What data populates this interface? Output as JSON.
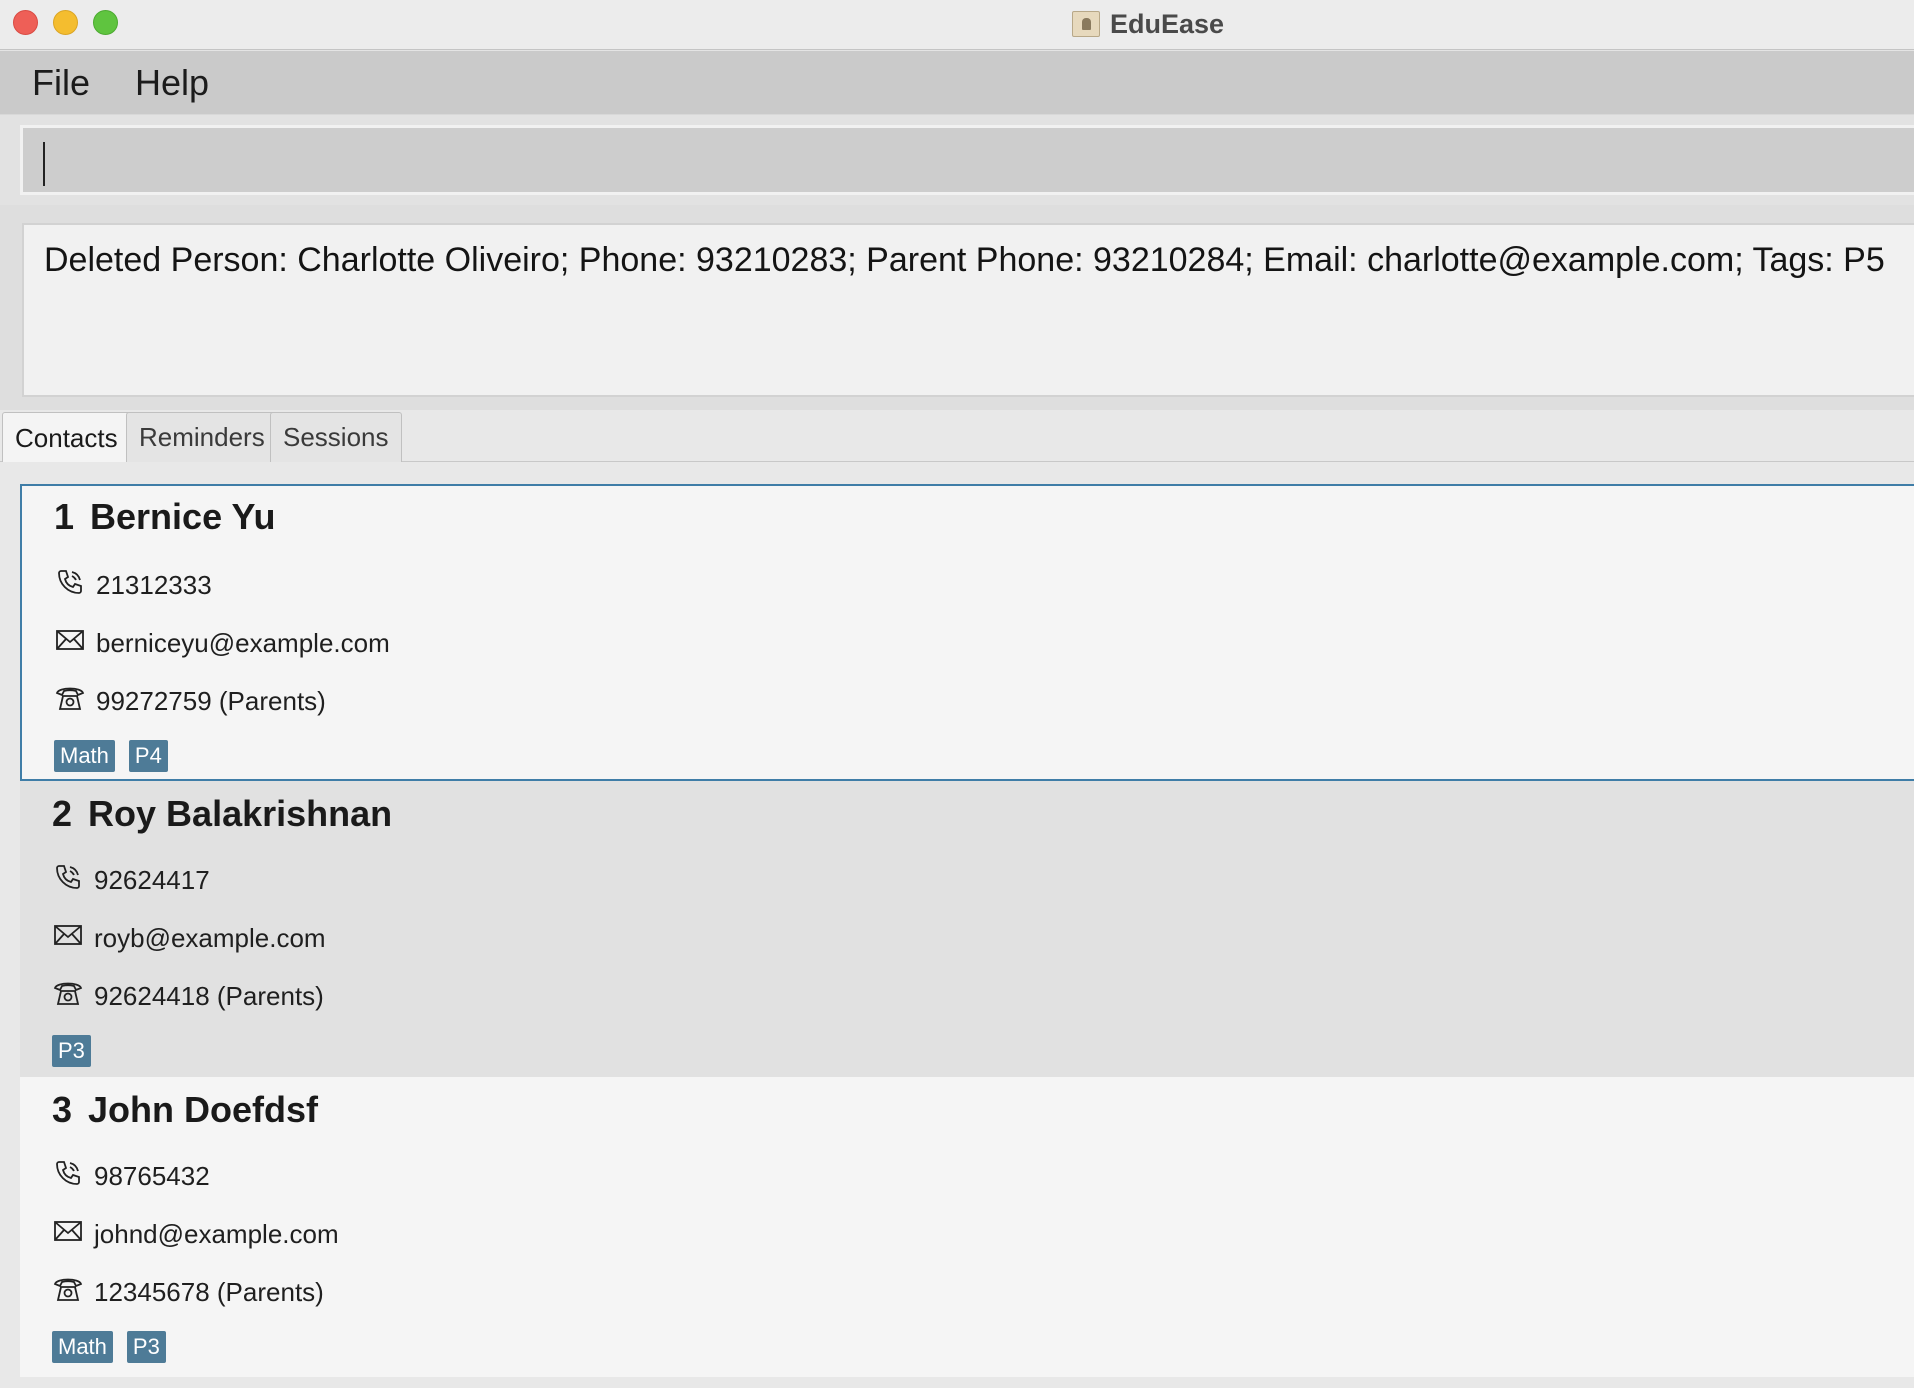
{
  "window": {
    "title": "EduEase",
    "controls": [
      "close",
      "minimize",
      "maximize"
    ]
  },
  "menu": {
    "items": [
      "File",
      "Help"
    ]
  },
  "command": {
    "value": ""
  },
  "result": {
    "text": "Deleted Person: Charlotte Oliveiro; Phone: 93210283; Parent Phone: 93210284; Email: charlotte@example.com; Tags: P5"
  },
  "tabs": [
    {
      "label": "Contacts",
      "active": true
    },
    {
      "label": "Reminders",
      "active": false
    },
    {
      "label": "Sessions",
      "active": false
    }
  ],
  "contacts": [
    {
      "index": "1",
      "name": "Bernice Yu",
      "phone": "21312333",
      "email": "berniceyu@example.com",
      "parent_phone": "99272759 (Parents)",
      "tags": [
        "Math",
        "P4"
      ],
      "selected": true
    },
    {
      "index": "2",
      "name": "Roy Balakrishnan",
      "phone": "92624417",
      "email": "royb@example.com",
      "parent_phone": "92624418 (Parents)",
      "tags": [
        "P3"
      ],
      "selected": false
    },
    {
      "index": "3",
      "name": "John Doefdsf",
      "phone": "98765432",
      "email": "johnd@example.com",
      "parent_phone": "12345678 (Parents)",
      "tags": [
        "Math",
        "P3"
      ],
      "selected": false
    }
  ],
  "icons": {
    "phone": "phone-icon",
    "email": "envelope-icon",
    "parent_phone": "telephone-icon"
  },
  "colors": {
    "selection_border": "#3f7da7",
    "tag_background": "#4e7b97"
  }
}
